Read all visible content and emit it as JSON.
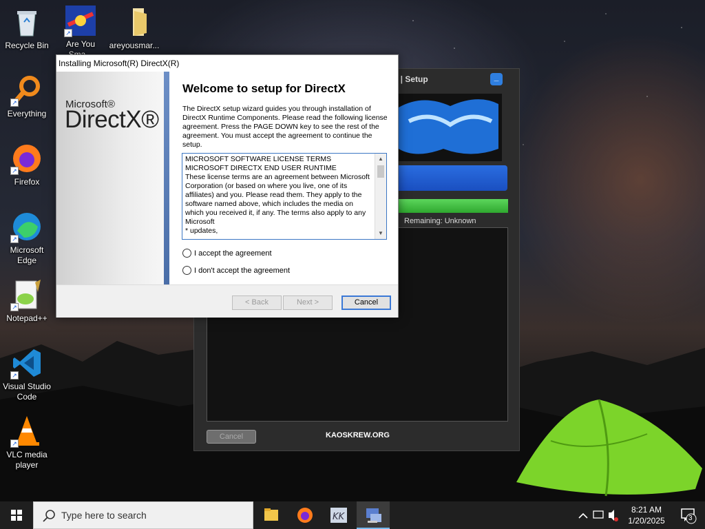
{
  "desktop": {
    "icons": [
      {
        "label": "Recycle Bin",
        "icon": "recycle-bin-icon"
      },
      {
        "label": "Are You Sma...",
        "icon": "game-shortcut-icon"
      },
      {
        "label": "areyousmar...",
        "icon": "folder-icon"
      },
      {
        "label": "Everything",
        "icon": "everything-search-icon"
      },
      {
        "label": "Firefox",
        "icon": "firefox-icon"
      },
      {
        "label": "Microsoft Edge",
        "icon": "edge-icon"
      },
      {
        "label": "Notepad++",
        "icon": "notepadpp-icon"
      },
      {
        "label": "Visual Studio Code",
        "icon": "vscode-icon"
      },
      {
        "label": "VLC media player",
        "icon": "vlc-icon"
      }
    ]
  },
  "setup_window": {
    "title": "ck | Setup",
    "minimize_label": "_",
    "remaining": "Remaining: Unknown",
    "cancel_label": "Cancel",
    "site": "KAOSKREW.ORG",
    "progress": 1.0
  },
  "dialog": {
    "title": "Installing Microsoft(R) DirectX(R)",
    "logo_small": "Microsoft®",
    "logo_big": "DirectX®",
    "heading": "Welcome to setup for DirectX",
    "intro": "The DirectX setup wizard guides you through installation of DirectX Runtime Components. Please read the following license agreement. Press the PAGE DOWN key to see the rest of the agreement. You must accept the agreement to continue the setup.",
    "license_lines": [
      "MICROSOFT SOFTWARE LICENSE TERMS",
      "MICROSOFT DIRECTX END USER RUNTIME",
      "These license terms are an agreement between Microsoft Corporation (or based on where you live, one of its affiliates) and you.  Please read them.  They apply to the software named above, which includes the media on which you received it, if any.  The terms also apply to any Microsoft",
      "* updates,"
    ],
    "radio_accept": "I accept the agreement",
    "radio_decline": "I don't accept the agreement",
    "back_label": "< Back",
    "next_label": "Next >",
    "cancel_label": "Cancel"
  },
  "taskbar": {
    "search_placeholder": "Type here to search",
    "apps": [
      "file-explorer-icon",
      "firefox-icon",
      "kk-app-icon",
      "setup-app-icon"
    ],
    "time": "8:21 AM",
    "date": "1/20/2025",
    "notification_count": "3"
  }
}
